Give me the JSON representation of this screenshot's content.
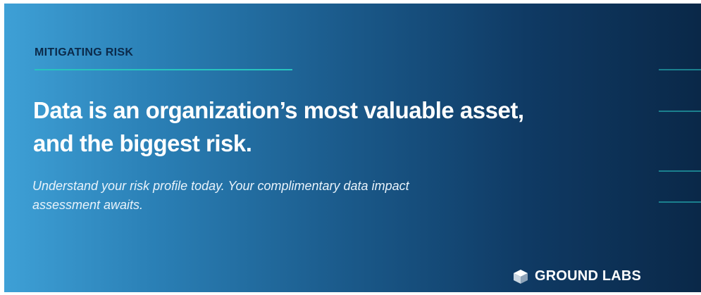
{
  "banner": {
    "eyebrow": "MITIGATING RISK",
    "headline_line1": "Data is an organization’s most valuable asset,",
    "headline_line2": "and the biggest risk.",
    "subtext_line1": "Understand your risk profile today. Your complimentary data impact",
    "subtext_line2": "assessment awaits.",
    "logo_text": "GROUND LABS",
    "logo_icon": "ground-labs-logo-icon"
  },
  "colors": {
    "gradient_start": "#3ea0d6",
    "gradient_end": "#0a2848",
    "eyebrow_text": "#0b2a4a",
    "accent_rule": "#27c4c0",
    "text": "#ffffff"
  }
}
